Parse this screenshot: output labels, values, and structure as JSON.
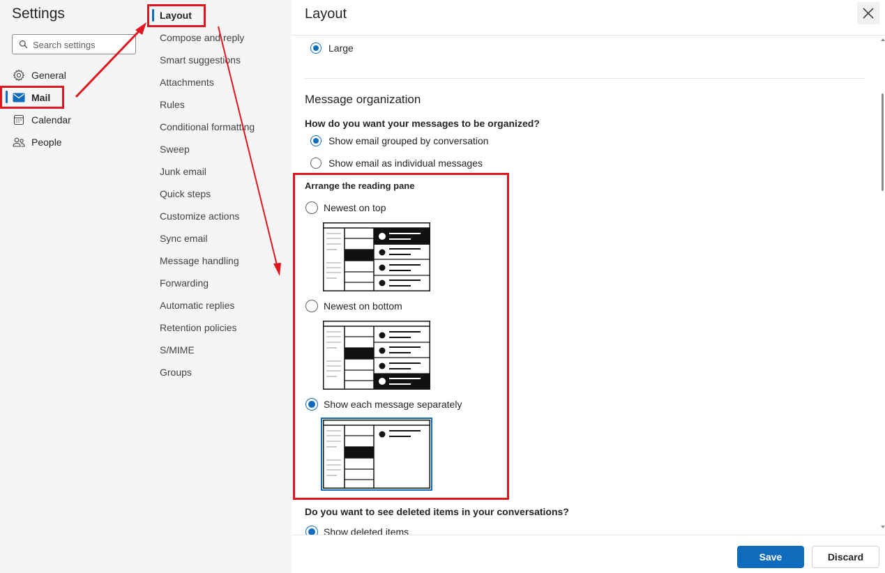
{
  "settings": {
    "title": "Settings"
  },
  "search": {
    "placeholder": "Search settings"
  },
  "categories": [
    {
      "label": "General",
      "icon": "gear-icon"
    },
    {
      "label": "Mail",
      "icon": "mail-icon",
      "selected": true
    },
    {
      "label": "Calendar",
      "icon": "calendar-icon"
    },
    {
      "label": "People",
      "icon": "people-icon"
    }
  ],
  "mail_subcategories": [
    {
      "label": "Layout",
      "selected": true
    },
    {
      "label": "Compose and reply"
    },
    {
      "label": "Smart suggestions"
    },
    {
      "label": "Attachments"
    },
    {
      "label": "Rules"
    },
    {
      "label": "Conditional formatting"
    },
    {
      "label": "Sweep"
    },
    {
      "label": "Junk email"
    },
    {
      "label": "Quick steps"
    },
    {
      "label": "Customize actions"
    },
    {
      "label": "Sync email"
    },
    {
      "label": "Message handling"
    },
    {
      "label": "Forwarding"
    },
    {
      "label": "Automatic replies"
    },
    {
      "label": "Retention policies"
    },
    {
      "label": "S/MIME"
    },
    {
      "label": "Groups"
    }
  ],
  "panel": {
    "title": "Layout",
    "close_icon": "close-icon",
    "text_size": {
      "option_large": "Large",
      "large_selected": true
    },
    "message_organization": {
      "heading": "Message organization",
      "question": "How do you want your messages to be organized?",
      "options": [
        {
          "label": "Show email grouped by conversation",
          "selected": true
        },
        {
          "label": "Show email as individual messages",
          "selected": false
        }
      ]
    },
    "reading_pane": {
      "heading": "Arrange the reading pane",
      "options": [
        {
          "label": "Newest on top",
          "selected": false
        },
        {
          "label": "Newest on bottom",
          "selected": false
        },
        {
          "label": "Show each message separately",
          "selected": true
        }
      ]
    },
    "deleted_items": {
      "question": "Do you want to see deleted items in your conversations?",
      "option": "Show deleted items",
      "selected": true
    }
  },
  "footer": {
    "save_label": "Save",
    "discard_label": "Discard"
  },
  "colors": {
    "accent": "#0f6cbd",
    "annotation": "#e0161f",
    "sidebar_bg": "#f5f5f5"
  }
}
